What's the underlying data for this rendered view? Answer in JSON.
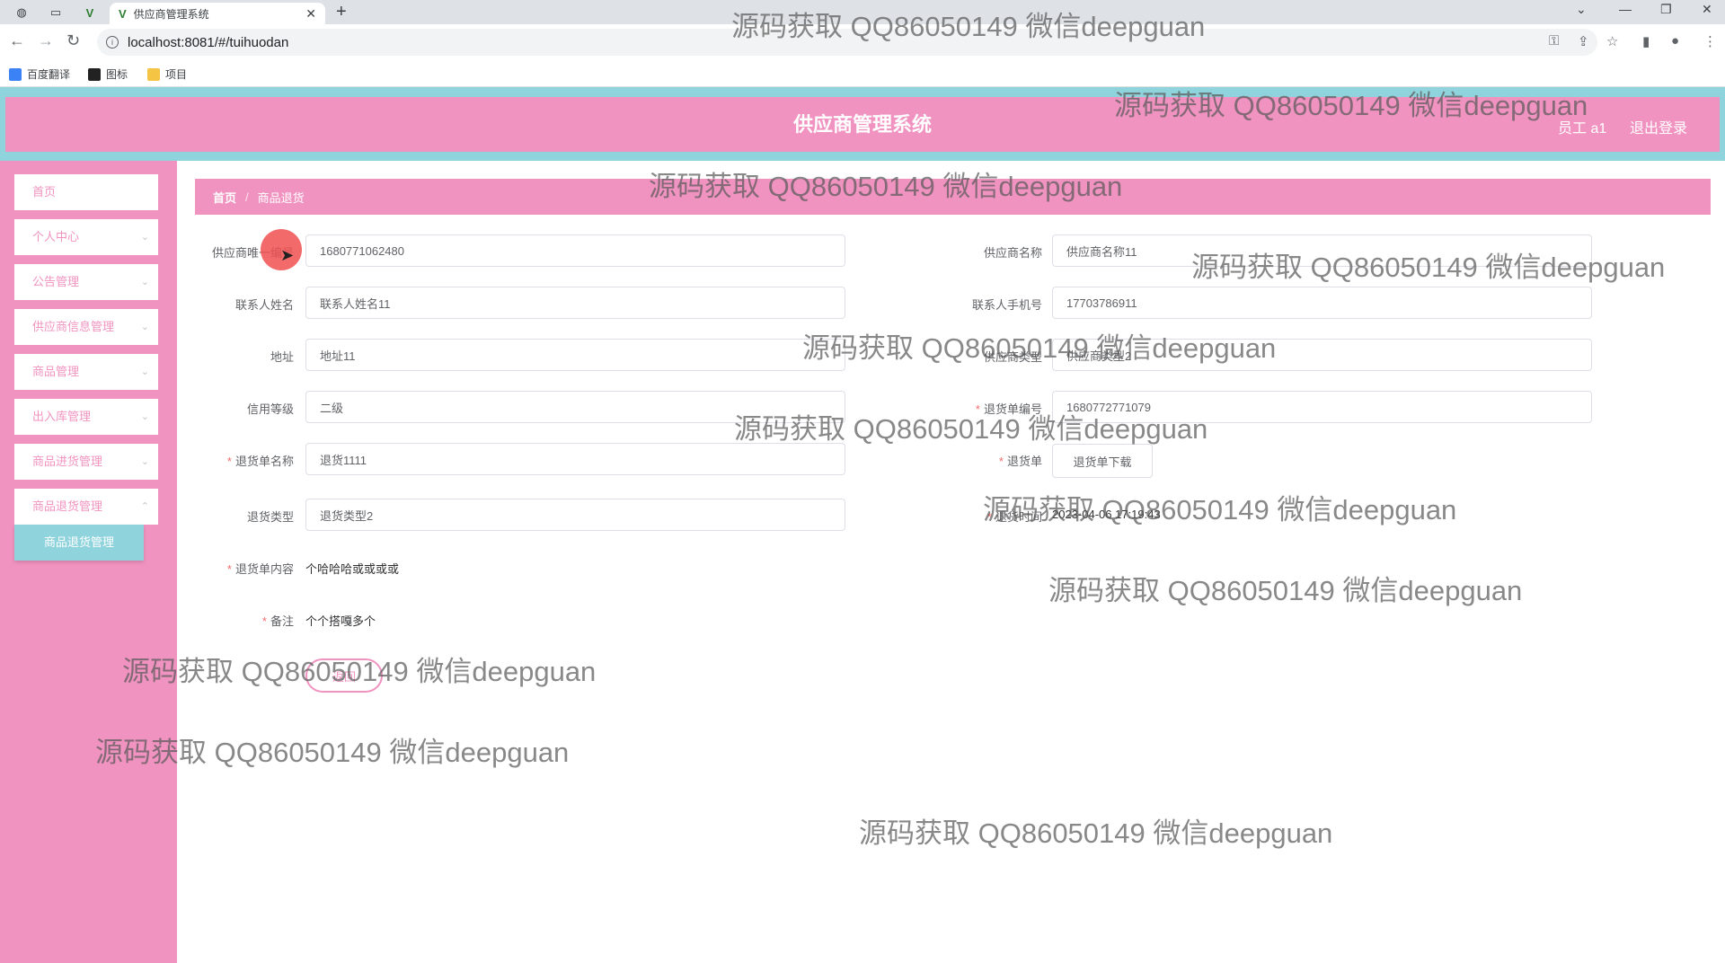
{
  "browser": {
    "tab_title": "供应商管理系统",
    "url": "localhost:8081/#/tuihuodan",
    "bookmarks": [
      "百度翻译",
      "图标",
      "项目"
    ]
  },
  "header": {
    "title": "供应商管理系统",
    "user": "员工 a1",
    "logout": "退出登录"
  },
  "sidebar": {
    "items": [
      "首页",
      "个人中心",
      "公告管理",
      "供应商信息管理",
      "商品管理",
      "出入库管理",
      "商品进货管理",
      "商品退货管理"
    ],
    "active_sub": "商品退货管理"
  },
  "breadcrumb": {
    "home": "首页",
    "current": "商品退货"
  },
  "form": {
    "supplier_id": {
      "label": "供应商唯一编号",
      "value": "1680771062480"
    },
    "supplier_name": {
      "label": "供应商名称",
      "value": "供应商名称11"
    },
    "contact_name": {
      "label": "联系人姓名",
      "value": "联系人姓名11"
    },
    "contact_phone": {
      "label": "联系人手机号",
      "value": "17703786911"
    },
    "address": {
      "label": "地址",
      "value": "地址11"
    },
    "supplier_type": {
      "label": "供应商类型",
      "value": "供应商类型2"
    },
    "credit_level": {
      "label": "信用等级",
      "value": "二级"
    },
    "return_no": {
      "label": "退货单编号",
      "value": "1680772771079"
    },
    "return_name": {
      "label": "退货单名称",
      "value": "退货1111"
    },
    "return_file": {
      "label": "退货单",
      "button": "退货单下载"
    },
    "return_type": {
      "label": "退货类型",
      "value": "退货类型2"
    },
    "return_time": {
      "label": "退货时间",
      "value": "2023-04-06 17:19:43"
    },
    "return_content": {
      "label": "退货单内容",
      "value": "个哈哈哈或或或或"
    },
    "remark": {
      "label": "备注",
      "value": "个个搭嘎多个"
    },
    "back_button": "返回"
  },
  "watermark": "源码获取 QQ86050149 微信deepguan"
}
